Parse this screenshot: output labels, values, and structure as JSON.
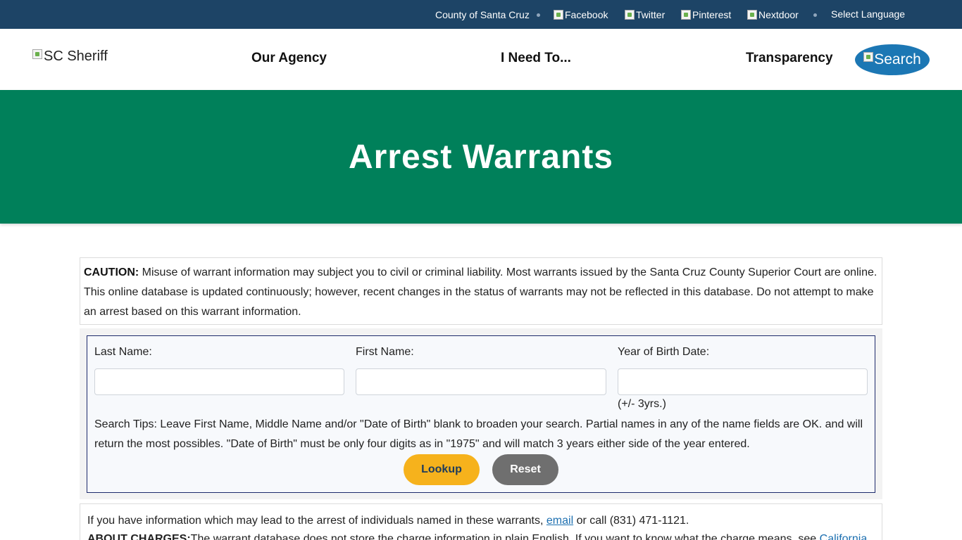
{
  "topbar": {
    "county_link": "County of Santa Cruz",
    "facebook": "Facebook",
    "twitter": "Twitter",
    "pinterest": "Pinterest",
    "nextdoor": "Nextdoor",
    "language": "Select Language"
  },
  "header": {
    "logo_alt": "SC Sheriff",
    "nav": [
      "Our Agency",
      "I Need To...",
      "Transparency"
    ],
    "search_label": "Search"
  },
  "hero": {
    "title": "Arrest Warrants"
  },
  "caution": {
    "label": "CAUTION:",
    "text": " Misuse of warrant information may subject you to civil or criminal liability. Most warrants issued by the Santa Cruz County Superior Court are online. This online database is updated continuously; however, recent changes in the status of warrants may not be reflected in this database. Do not attempt to make an arrest based on this warrant information."
  },
  "form": {
    "last_name_label": "Last Name:",
    "first_name_label": "First Name:",
    "birth_year_label": "Year of Birth Date:",
    "last_name_value": "",
    "first_name_value": "",
    "birth_year_value": "",
    "birth_year_hint": "(+/- 3yrs.)",
    "tips": "Search Tips: Leave First Name, Middle Name and/or \"Date of Birth\" blank to broaden your search. Partial names in any of the name fields are OK. and will return the most possibles. \"Date of Birth\" must be only four digits as in \"1975\" and will match 3 years either side of the year entered.",
    "lookup_label": "Lookup",
    "reset_label": "Reset"
  },
  "info": {
    "prefix": "If you have information which may lead to the arrest of individuals named in these warrants, ",
    "email_link": "email",
    "suffix": " or call (831) 471-1121.",
    "charges_label": "ABOUT CHARGES:",
    "charges_text": "The warrant database does not store the charge information in plain English. If you want to know what the charge means, see ",
    "charges_link": "California"
  },
  "colors": {
    "topbar": "#1d4466",
    "hero": "#00805a",
    "search_button": "#1c77b4",
    "lookup_button": "#f6b21c",
    "reset_button": "#6f6f6f",
    "link": "#1c6fb0"
  }
}
